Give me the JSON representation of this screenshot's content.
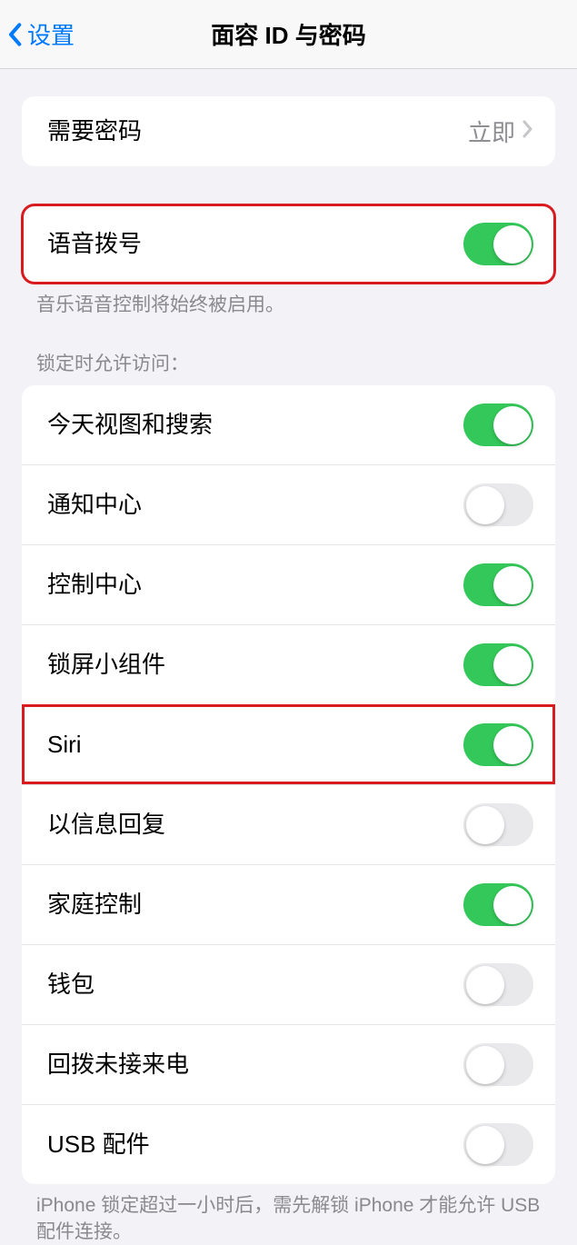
{
  "nav": {
    "back_label": "设置",
    "title": "面容 ID 与密码"
  },
  "require_passcode": {
    "label": "需要密码",
    "value": "立即"
  },
  "voice_dial": {
    "label": "语音拨号",
    "footer": "音乐语音控制将始终被启用。"
  },
  "lock_access": {
    "header": "锁定时允许访问：",
    "items": {
      "today": {
        "label": "今天视图和搜索",
        "on": true
      },
      "notification": {
        "label": "通知中心",
        "on": false
      },
      "control": {
        "label": "控制中心",
        "on": true
      },
      "widgets": {
        "label": "锁屏小组件",
        "on": true
      },
      "siri": {
        "label": "Siri",
        "on": true
      },
      "reply": {
        "label": "以信息回复",
        "on": false
      },
      "home": {
        "label": "家庭控制",
        "on": true
      },
      "wallet": {
        "label": "钱包",
        "on": false
      },
      "callback": {
        "label": "回拨未接来电",
        "on": false
      },
      "usb": {
        "label": "USB 配件",
        "on": false
      }
    },
    "footer": "iPhone 锁定超过一小时后，需先解锁 iPhone 才能允许 USB 配件连接。"
  }
}
